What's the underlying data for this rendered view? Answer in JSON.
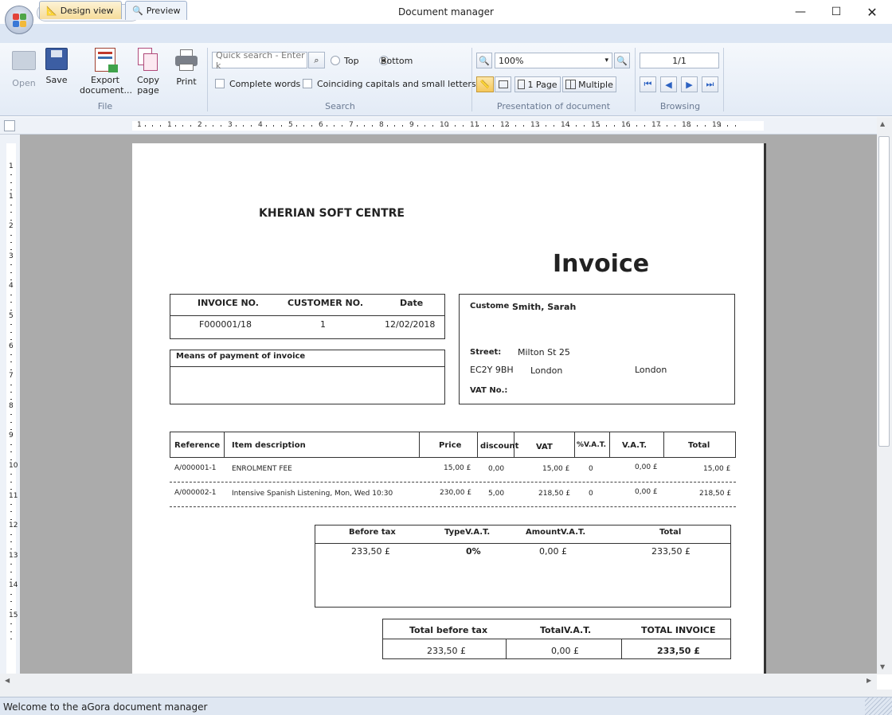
{
  "window": {
    "title": "Document manager"
  },
  "tabs": [
    {
      "label": "Design view"
    },
    {
      "label": "Preview"
    }
  ],
  "ribbon": {
    "file": {
      "label": "File",
      "open": "Open",
      "save": "Save",
      "export": "Export document...",
      "copy": "Copy page",
      "print": "Print"
    },
    "search": {
      "label": "Search",
      "placeholder": "Quick search - Enter k",
      "top": "Top",
      "bottom": "Bottom",
      "complete_words": "Complete words",
      "coinciding": "Coinciding capitals and small letters"
    },
    "presentation": {
      "label": "Presentation of document",
      "zoom": "100%",
      "one_page": "1 Page",
      "multiple": "Multiple"
    },
    "browsing": {
      "label": "Browsing",
      "page": "1/1"
    }
  },
  "ruler": {
    "h": [
      "1",
      "1",
      "2",
      "3",
      "4",
      "5",
      "6",
      "7",
      "8",
      "9",
      "10",
      "11",
      "12",
      "13",
      "14",
      "15",
      "16",
      "17",
      "18",
      "19"
    ],
    "v": [
      "1",
      "1",
      "2",
      "3",
      "4",
      "5",
      "6",
      "7",
      "8",
      "9",
      "10",
      "11",
      "12",
      "13",
      "14",
      "15"
    ]
  },
  "invoice": {
    "company": "KHERIAN SOFT CENTRE",
    "title": "Invoice",
    "headers": {
      "invoice_no": "INVOICE NO.",
      "customer_no": "CUSTOMER NO.",
      "date": "Date"
    },
    "values": {
      "invoice_no": "F000001/18",
      "customer_no": "1",
      "date": "12/02/2018"
    },
    "payment_label": "Means of payment of invoice",
    "customer": {
      "label": "Custome",
      "name": "Smith, Sarah",
      "street_label": "Street:",
      "street": "Milton St 25",
      "postcode": "EC2Y 9BH",
      "city": "London",
      "region": "London",
      "vat_label": "VAT No.:"
    },
    "items_headers": {
      "ref": "Reference",
      "desc": "Item description",
      "price": "Price",
      "discount": "discount",
      "vat": "VAT",
      "pct": "%V.A.T.",
      "vat2": "V.A.T.",
      "total": "Total"
    },
    "items": [
      {
        "ref": "A/000001-1",
        "desc": "ENROLMENT FEE",
        "price": "15,00 £",
        "discount": "0,00",
        "vat": "15,00 £",
        "pct": "0",
        "vat2": "0,00 £",
        "total": "15,00 £"
      },
      {
        "ref": "A/000002-1",
        "desc": "Intensive Spanish Listening, Mon, Wed 10:30",
        "price": "230,00 £",
        "discount": "5,00",
        "vat": "218,50 £",
        "pct": "0",
        "vat2": "0,00 £",
        "total": "218,50 £"
      }
    ],
    "tax_headers": {
      "before": "Before tax",
      "type": "TypeV.A.T.",
      "amount": "AmountV.A.T.",
      "total": "Total"
    },
    "tax_values": {
      "before": "233,50 £",
      "type": "0%",
      "amount": "0,00 £",
      "total": "233,50 £"
    },
    "totals_headers": {
      "before": "Total before tax",
      "vat": "TotalV.A.T.",
      "invoice": "TOTAL INVOICE"
    },
    "totals_values": {
      "before": "233,50 £",
      "vat": "0,00 £",
      "invoice": "233,50 £"
    }
  },
  "status": "Welcome to the aGora document manager"
}
